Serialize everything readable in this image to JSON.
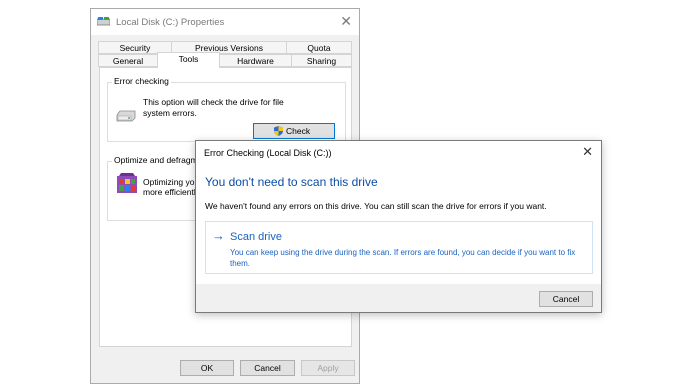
{
  "properties": {
    "title": "Local Disk (C:) Properties",
    "close_glyph": "✕",
    "tabs_row1": [
      "Security",
      "Previous Versions",
      "Quota"
    ],
    "tabs_row2": [
      "General",
      "Tools",
      "Hardware",
      "Sharing"
    ],
    "active_tab": "Tools",
    "error_checking": {
      "label": "Error checking",
      "description": "This option will check the drive for file system errors.",
      "check_button": "Check"
    },
    "optimize": {
      "label": "Optimize and defragment drive",
      "description_line1": "Optimizing your",
      "description_line2": "more efficiently"
    },
    "buttons": {
      "ok": "OK",
      "cancel": "Cancel",
      "apply": "Apply"
    }
  },
  "error_dialog": {
    "title": "Error Checking (Local Disk (C:))",
    "close_glyph": "✕",
    "heading": "You don't need to scan this drive",
    "message": "We haven't found any errors on this drive. You can still scan the drive for errors if you want.",
    "scan_option": {
      "arrow": "→",
      "title": "Scan drive",
      "description": "You can keep using the drive during the scan. If errors are found, you can decide if you want to fix them."
    },
    "cancel_button": "Cancel"
  },
  "colors": {
    "accent_blue": "#1b62c2",
    "heading_blue": "#0b4ca8",
    "focus_border": "#0078d7"
  },
  "icons": [
    "drive-icon",
    "hard-disk-icon",
    "uac-shield-icon",
    "defrag-icon",
    "arrow-right-icon",
    "close-icon"
  ]
}
